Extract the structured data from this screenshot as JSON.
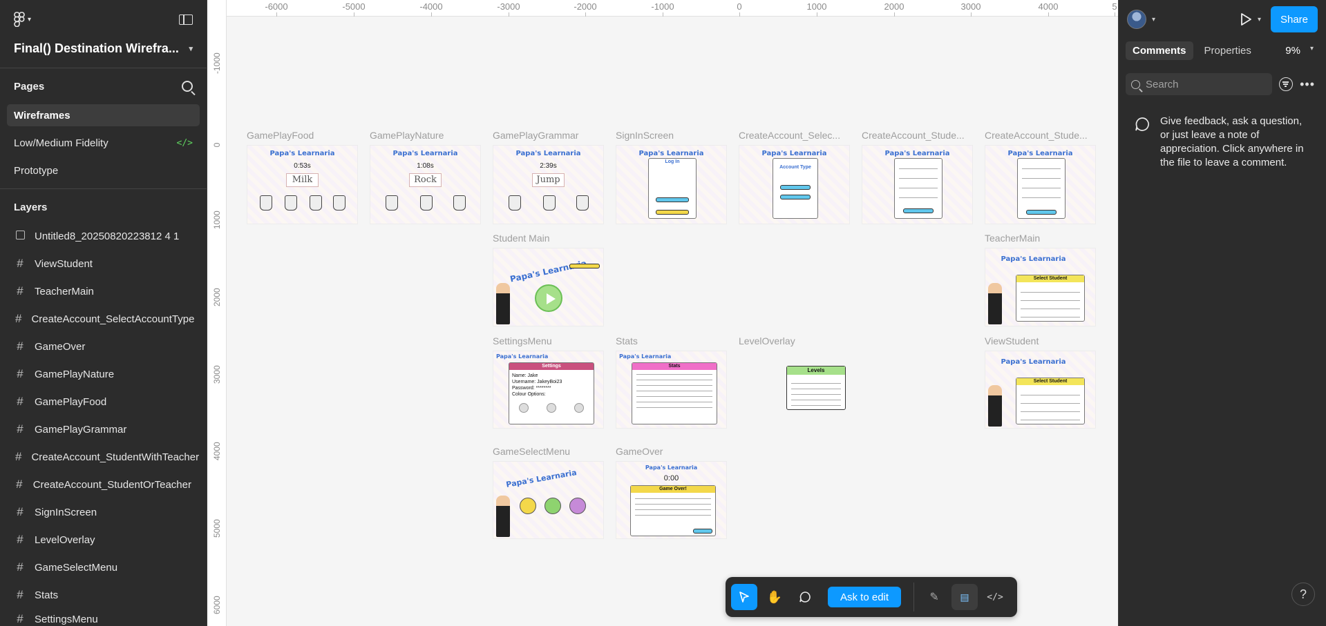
{
  "file": {
    "title": "Final() Destination Wirefra..."
  },
  "pages": {
    "heading": "Pages",
    "items": [
      {
        "label": "Wireframes",
        "active": true
      },
      {
        "label": "Low/Medium Fidelity",
        "active": false
      },
      {
        "label": "Prototype",
        "active": false
      }
    ]
  },
  "layers": {
    "heading": "Layers",
    "items": [
      {
        "label": "Untitled8_20250820223812 4 1",
        "icon": "image-icon"
      },
      {
        "label": "ViewStudent",
        "icon": "frame-icon"
      },
      {
        "label": "TeacherMain",
        "icon": "frame-icon"
      },
      {
        "label": "CreateAccount_SelectAccountType",
        "icon": "frame-icon"
      },
      {
        "label": "GameOver",
        "icon": "frame-icon"
      },
      {
        "label": "GamePlayNature",
        "icon": "frame-icon"
      },
      {
        "label": "GamePlayFood",
        "icon": "frame-icon"
      },
      {
        "label": "GamePlayGrammar",
        "icon": "frame-icon"
      },
      {
        "label": "CreateAccount_StudentWithTeacher",
        "icon": "frame-icon"
      },
      {
        "label": "CreateAccount_StudentOrTeacher",
        "icon": "frame-icon"
      },
      {
        "label": "SignInScreen",
        "icon": "frame-icon"
      },
      {
        "label": "LevelOverlay",
        "icon": "frame-icon"
      },
      {
        "label": "GameSelectMenu",
        "icon": "frame-icon"
      },
      {
        "label": "Stats",
        "icon": "frame-icon"
      },
      {
        "label": "SettingsMenu",
        "icon": "frame-icon"
      }
    ]
  },
  "rulers": {
    "horizontal": [
      "-6000",
      "-5000",
      "-4000",
      "-3000",
      "-2000",
      "-1000",
      "0",
      "1000",
      "2000",
      "3000",
      "4000",
      "5"
    ],
    "vertical": [
      "-1000",
      "0",
      "1000",
      "2000",
      "3000",
      "4000",
      "5000",
      "6000"
    ]
  },
  "frames": {
    "gameplay_food": {
      "label": "GamePlayFood",
      "title": "Papa's Learnaria",
      "time": "0:53s",
      "word": "Milk"
    },
    "gameplay_nature": {
      "label": "GamePlayNature",
      "title": "Papa's Learnaria",
      "time": "1:08s",
      "word": "Rock"
    },
    "gameplay_grammar": {
      "label": "GamePlayGrammar",
      "title": "Papa's Learnaria",
      "time": "2:39s",
      "word": "Jump"
    },
    "signin": {
      "label": "SignInScreen",
      "title": "Papa's Learnaria",
      "panel_title": "Log In"
    },
    "create_select": {
      "label": "CreateAccount_Selec...",
      "title": "Papa's Learnaria",
      "panel_title": "Account Type"
    },
    "create_student1": {
      "label": "CreateAccount_Stude...",
      "title": "Papa's Learnaria"
    },
    "create_student2": {
      "label": "CreateAccount_Stude...",
      "title": "Papa's Learnaria"
    },
    "student_main": {
      "label": "Student Main",
      "title": "Papa's Learnaria"
    },
    "teacher_main": {
      "label": "TeacherMain",
      "title": "Papa's Learnaria",
      "panel_title": "Select Student"
    },
    "settings": {
      "label": "SettingsMenu",
      "title": "Papa's Learnaria",
      "panel_title": "Settings",
      "name": "Name: Jake",
      "username": "Username: JakeyBoi23",
      "password": "Password: ********",
      "colour": "Colour Options:"
    },
    "stats": {
      "label": "Stats",
      "title": "Papa's Learnaria",
      "panel_title": "Stats"
    },
    "level_overlay": {
      "label": "LevelOverlay",
      "panel_title": "Levels"
    },
    "view_student": {
      "label": "ViewStudent",
      "title": "Papa's Learnaria",
      "panel_title": "Select Student"
    },
    "game_select": {
      "label": "GameSelectMenu",
      "title": "Papa's Learnaria"
    },
    "game_over": {
      "label": "GameOver",
      "title": "Papa's Learnaria",
      "time": "0:00",
      "panel_title": "Game Over!"
    }
  },
  "toolbar": {
    "ask_to_edit": "Ask to edit"
  },
  "right_panel": {
    "share": "Share",
    "tabs": [
      "Comments",
      "Properties"
    ],
    "zoom": "9%",
    "search_placeholder": "Search",
    "hint": "Give feedback, ask a question, or just leave a note of appreciation. Click anywhere in the file to leave a comment.",
    "help": "?"
  },
  "colors": {
    "accent": "#0d99ff",
    "panel_bg": "#2c2c2c",
    "canvas_bg": "#f5f5f5"
  }
}
